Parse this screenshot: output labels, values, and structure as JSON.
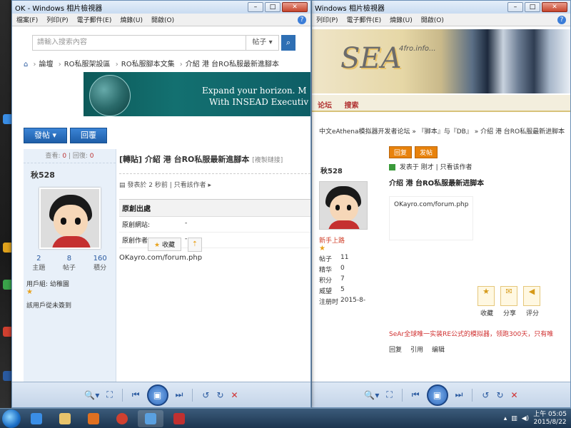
{
  "desktop": {
    "icon_colors": [
      "#3a8ee6",
      "#e0a21c",
      "#3aa34a",
      "#d04030",
      "#2a5aa0"
    ]
  },
  "left_window": {
    "title": "OK - Windows 相片檢視器",
    "menu": [
      "檔案(F)",
      "列印(P)",
      "電子郵件(E)",
      "燒錄(U)",
      "開啟(O)"
    ],
    "search": {
      "placeholder": "請輸入搜索內容",
      "scope": "帖子"
    },
    "breadcrumb": [
      "論壇",
      "RO私服架設區",
      "RO私服腳本文集",
      "介紹 港 台RO私服最新進腳本"
    ],
    "banner": {
      "line1": "Expand your horizon. M",
      "line2": "With INSEAD Executiv"
    },
    "buttons": {
      "post": "發帖",
      "reply": "回覆"
    },
    "sidebar": {
      "views_label": "查看:",
      "views": "0",
      "replies_label": "回復:",
      "replies": "0",
      "username": "秋528",
      "stats": [
        {
          "value": "2",
          "label": "主題"
        },
        {
          "value": "8",
          "label": "帖子"
        },
        {
          "value": "160",
          "label": "積分"
        }
      ],
      "group": "用戶組: 幼稚園",
      "status": "該用戶從未簽到"
    },
    "post": {
      "tag": "[轉貼]",
      "title": "介紹 港 台RO私服最新進腳本",
      "copy_link": "[複製鏈接]",
      "meta": "發表於 2 秒前",
      "author_only": "只看該作者",
      "orig_head": "原創出處",
      "orig_site_label": "原創網站:",
      "orig_site_value": "-",
      "orig_author_label": "原創作者:",
      "orig_author_value": "-",
      "url": "OKayro.com/forum.php",
      "fav": "收藏"
    }
  },
  "right_window": {
    "title": "Windows 相片檢視器",
    "menu": [
      "列印(P)",
      "電子郵件(E)",
      "燒錄(U)",
      "開啟(O)"
    ],
    "logo": "SEA",
    "logo_sub": "4fro.info...",
    "nav": [
      "论坛",
      "搜索"
    ],
    "breadcrumb": "中文eAthena模拟器开发者论坛 » 『脚本』与『DB』 » 介绍 港 台RO私服最新进脚本",
    "buttons": {
      "reply": "回复",
      "post": "发帖"
    },
    "user": {
      "name": "秋528",
      "level": "新手上路",
      "stats": [
        {
          "label": "帖子",
          "value": "11"
        },
        {
          "label": "精华",
          "value": "0"
        },
        {
          "label": "积分",
          "value": "7"
        },
        {
          "label": "威望",
          "value": "5"
        },
        {
          "label": "注册时",
          "value": "2015-8-"
        }
      ]
    },
    "post": {
      "meta": "发表于 刚才",
      "author_only": "只看该作者",
      "title": "介绍 港 台RO私服最新进脚本",
      "url": "OKayro.com/forum.php",
      "actions": [
        "收藏",
        "分享",
        "评分"
      ],
      "ad": "SeAr全球唯一实装RE公式的模拟器，领跑300天，只有唯",
      "footer": [
        "回复",
        "引用",
        "编辑"
      ]
    }
  },
  "taskbar": {
    "time": "上午 05:05",
    "date": "2015/8/22"
  }
}
